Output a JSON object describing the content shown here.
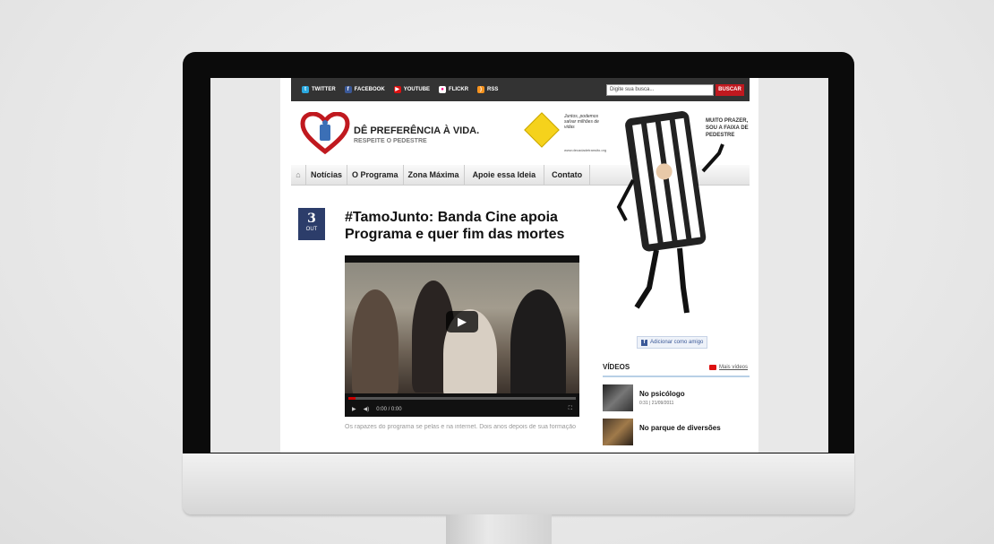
{
  "social": [
    {
      "label": "TWITTER",
      "icon": "twitter-icon",
      "color": "#2aa9e0"
    },
    {
      "label": "FACEBOOK",
      "icon": "facebook-icon",
      "color": "#3b5998"
    },
    {
      "label": "YOUTUBE",
      "icon": "youtube-icon",
      "color": "#d11"
    },
    {
      "label": "FLICKR",
      "icon": "flickr-icon",
      "color": "#ff0084"
    },
    {
      "label": "RSS",
      "icon": "rss-icon",
      "color": "#f7931e"
    }
  ],
  "search": {
    "placeholder": "Digite sua busca...",
    "button": "BUSCAR"
  },
  "logo": {
    "title": "DÊ PREFERÊNCIA À VIDA.",
    "subtitle": "RESPEITE O PEDESTRE",
    "icon": "heart-logo-icon",
    "color": "#c0191f"
  },
  "sign": {
    "text": "Juntos, podemos salvar milhões de vidas",
    "url": "www.decadadetransito.org",
    "color": "#f5d21c"
  },
  "nav": {
    "home_icon": "home-icon",
    "items": [
      "Notícias",
      "O Programa",
      "Zona Máxima",
      "Apoie essa Ideia",
      "Contato"
    ]
  },
  "article": {
    "day": "3",
    "month": "OUT",
    "title": "#TamoJunto: Banda Cine apoia Programa e quer fim das mortes",
    "video_time": "0:00 / 0:00",
    "caption": "Os rapazes do programa se pelas e na internet. Dois anos depois de sua formação"
  },
  "mascot": {
    "speech": "MUITO PRAZER, SOU A FAIXA DE PEDESTRE"
  },
  "facebook": {
    "add_friend": "Adicionar como amigo"
  },
  "videos": {
    "heading": "VÍDEOS",
    "more": "Mais vídeos",
    "items": [
      {
        "title": "No psicólogo",
        "meta": "0:31 | 21/09/2011"
      },
      {
        "title": "No parque de diversões",
        "meta": ""
      }
    ]
  }
}
